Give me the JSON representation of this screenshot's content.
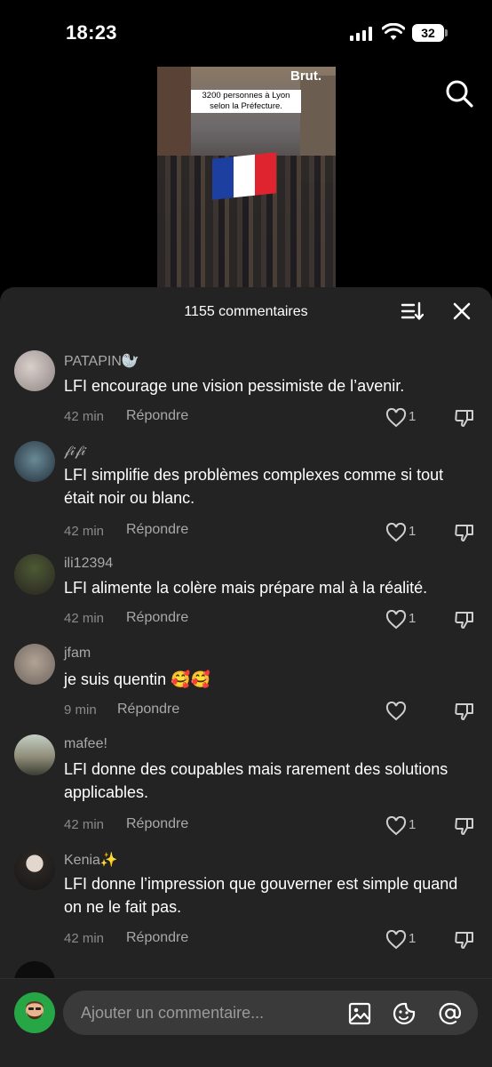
{
  "status_bar": {
    "time": "18:23",
    "battery": "32"
  },
  "video": {
    "caption": "3200 personnes à Lyon selon la Préfecture.",
    "brand": "Brut."
  },
  "comments_header": {
    "count_label": "1155 commentaires"
  },
  "comments": [
    {
      "username": "PATAPIN🦭",
      "text": "LFI encourage une vision pessimiste de l’avenir.",
      "time": "42 min",
      "reply": "Répondre",
      "likes": "1"
    },
    {
      "username": "𝒻𝒾𝒻𝒾",
      "text": "LFI simplifie des problèmes complexes comme si tout était noir ou blanc.",
      "time": "42 min",
      "reply": "Répondre",
      "likes": "1"
    },
    {
      "username": "ili12394",
      "text": "LFI alimente la colère mais prépare mal à la réalité.",
      "time": "42 min",
      "reply": "Répondre",
      "likes": "1"
    },
    {
      "username": "jfam",
      "text": "je suis quentin 🥰🥰",
      "time": "9 min",
      "reply": "Répondre",
      "likes": ""
    },
    {
      "username": "mafee!",
      "text": "LFI donne des coupables mais rarement des solutions applicables.",
      "time": "42 min",
      "reply": "Répondre",
      "likes": "1"
    },
    {
      "username": "Kenia✨",
      "text": "LFI donne l’impression que gouverner est simple quand on ne le fait pas.",
      "time": "42 min",
      "reply": "Répondre",
      "likes": "1"
    }
  ],
  "comment_input": {
    "placeholder": "Ajouter un commentaire..."
  },
  "icons": {
    "search": "search-icon",
    "sort": "sort-icon",
    "close": "close-icon",
    "like": "heart-icon",
    "dislike": "thumbs-down-icon",
    "image": "image-icon",
    "emoji": "emoji-icon",
    "mention": "at-icon"
  },
  "colors": {
    "sheet_bg": "#232323",
    "flag_blue": "#1d3fa0",
    "flag_white": "#ffffff",
    "flag_red": "#e0242f"
  }
}
